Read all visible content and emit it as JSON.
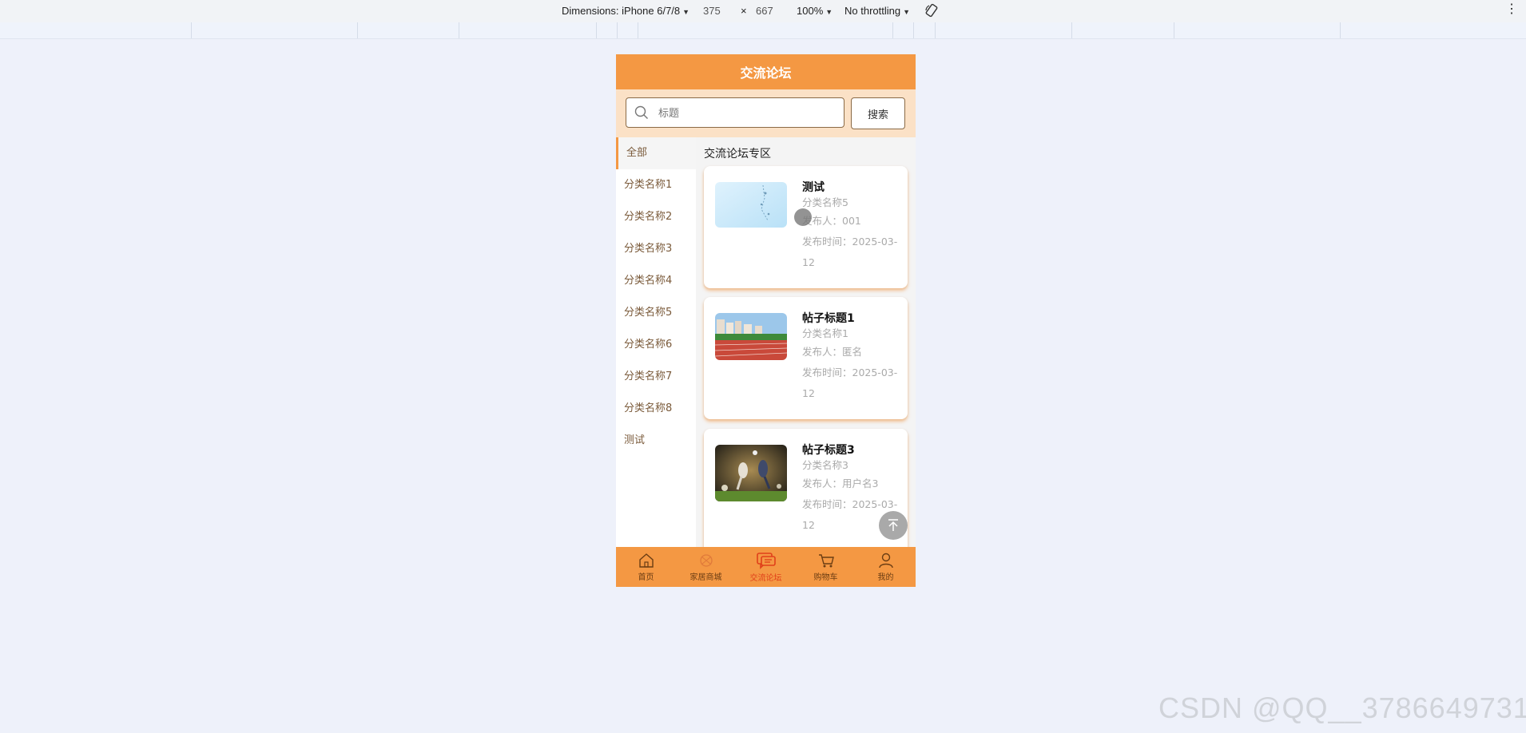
{
  "devtools": {
    "dimensions_label": "Dimensions: iPhone 6/7/8",
    "width": "375",
    "times": "×",
    "height": "667",
    "zoom": "100%",
    "throttling": "No throttling",
    "menu": "⋮"
  },
  "app": {
    "title": "交流论坛",
    "search": {
      "placeholder": "标题",
      "button": "搜索"
    },
    "categories": [
      "全部",
      "分类名称1",
      "分类名称2",
      "分类名称3",
      "分类名称4",
      "分类名称5",
      "分类名称6",
      "分类名称7",
      "分类名称8",
      "测试"
    ],
    "active_category": "全部",
    "section_title": "交流论坛专区",
    "posts": [
      {
        "title": "测试",
        "category": "分类名称5",
        "author": "发布人：001",
        "time": "发布时间：2025-03-12"
      },
      {
        "title": "帖子标题1",
        "category": "分类名称1",
        "author": "发布人：匿名",
        "time": "发布时间：2025-03-12"
      },
      {
        "title": "帖子标题3",
        "category": "分类名称3",
        "author": "发布人：用户名3",
        "time": "发布时间：2025-03-12"
      }
    ],
    "tabs": [
      {
        "label": "首页",
        "icon": "home-icon"
      },
      {
        "label": "家居商城",
        "icon": "mall-icon"
      },
      {
        "label": "交流论坛",
        "icon": "forum-icon"
      },
      {
        "label": "购物车",
        "icon": "cart-icon"
      },
      {
        "label": "我的",
        "icon": "user-icon"
      }
    ],
    "active_tab": "交流论坛",
    "colors": {
      "primary": "#f49843",
      "search_bg": "#fbe1c6",
      "active_tab": "#e0401a"
    }
  },
  "watermark": "CSDN @QQ__3786649731"
}
